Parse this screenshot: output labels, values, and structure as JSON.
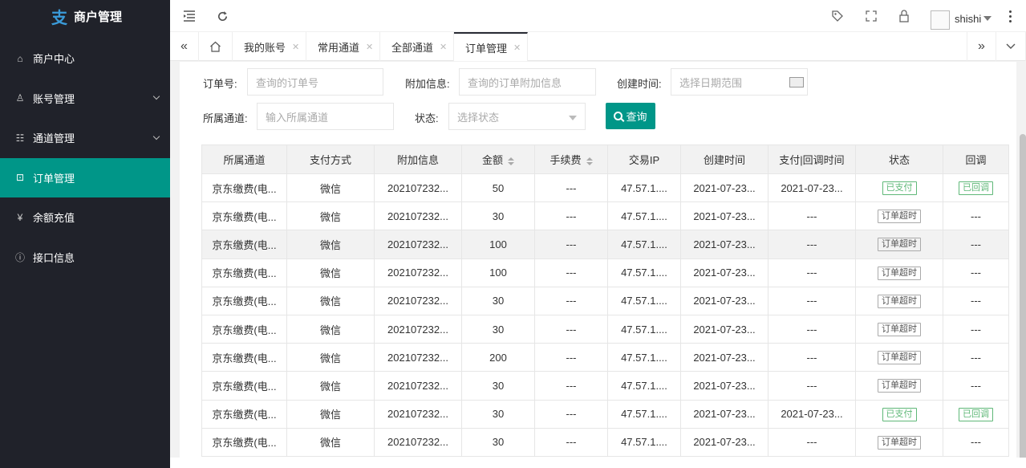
{
  "app": {
    "title": "商户管理"
  },
  "sidebar": {
    "items": [
      {
        "label": "商户中心",
        "icon": "home-icon",
        "glyph": "⌂",
        "expandable": false
      },
      {
        "label": "账号管理",
        "icon": "user-icon",
        "glyph": "♙",
        "expandable": true
      },
      {
        "label": "通道管理",
        "icon": "channel-icon",
        "glyph": "☷",
        "expandable": true
      },
      {
        "label": "订单管理",
        "icon": "cart-icon",
        "glyph": "⊡",
        "expandable": false,
        "active": true
      },
      {
        "label": "余额充值",
        "icon": "yen-icon",
        "glyph": "¥",
        "expandable": false
      },
      {
        "label": "接口信息",
        "icon": "info-icon",
        "glyph": "ⓘ",
        "expandable": false
      }
    ]
  },
  "header": {
    "user_name": "shishi"
  },
  "tabs": [
    {
      "label": "我的账号"
    },
    {
      "label": "常用通道"
    },
    {
      "label": "全部通道"
    },
    {
      "label": "订单管理",
      "active": true
    }
  ],
  "filters": {
    "order_no_label": "订单号:",
    "order_no_placeholder": "查询的订单号",
    "extra_label": "附加信息:",
    "extra_placeholder": "查询的订单附加信息",
    "created_label": "创建时间:",
    "created_placeholder": "选择日期范围",
    "channel_label": "所属通道:",
    "channel_placeholder": "输入所属通道",
    "status_label": "状态:",
    "status_placeholder": "选择状态",
    "query_button": "查询"
  },
  "table": {
    "columns": [
      "所属通道",
      "支付方式",
      "附加信息",
      "金额",
      "手续费",
      "交易IP",
      "创建时间",
      "支付|回调时间",
      "状态",
      "回调"
    ],
    "rows": [
      {
        "channel": "京东缴费(电...",
        "method": "微信",
        "extra": "202107232...",
        "amount": "50",
        "fee": "---",
        "ip": "47.57.1....",
        "created": "2021-07-23...",
        "paid": "2021-07-23...",
        "status": "已支付",
        "status_type": "green",
        "callback": "已回调",
        "callback_type": "green"
      },
      {
        "channel": "京东缴费(电...",
        "method": "微信",
        "extra": "202107232...",
        "amount": "30",
        "fee": "---",
        "ip": "47.57.1....",
        "created": "2021-07-23...",
        "paid": "---",
        "status": "订单超时",
        "status_type": "gray",
        "callback": "---",
        "callback_type": "text"
      },
      {
        "channel": "京东缴费(电...",
        "method": "微信",
        "extra": "202107232...",
        "amount": "100",
        "fee": "---",
        "ip": "47.57.1....",
        "created": "2021-07-23...",
        "paid": "---",
        "status": "订单超时",
        "status_type": "gray",
        "callback": "---",
        "callback_type": "text",
        "highlight": true
      },
      {
        "channel": "京东缴费(电...",
        "method": "微信",
        "extra": "202107232...",
        "amount": "100",
        "fee": "---",
        "ip": "47.57.1....",
        "created": "2021-07-23...",
        "paid": "---",
        "status": "订单超时",
        "status_type": "gray",
        "callback": "---",
        "callback_type": "text"
      },
      {
        "channel": "京东缴费(电...",
        "method": "微信",
        "extra": "202107232...",
        "amount": "30",
        "fee": "---",
        "ip": "47.57.1....",
        "created": "2021-07-23...",
        "paid": "---",
        "status": "订单超时",
        "status_type": "gray",
        "callback": "---",
        "callback_type": "text"
      },
      {
        "channel": "京东缴费(电...",
        "method": "微信",
        "extra": "202107232...",
        "amount": "30",
        "fee": "---",
        "ip": "47.57.1....",
        "created": "2021-07-23...",
        "paid": "---",
        "status": "订单超时",
        "status_type": "gray",
        "callback": "---",
        "callback_type": "text"
      },
      {
        "channel": "京东缴费(电...",
        "method": "微信",
        "extra": "202107232...",
        "amount": "200",
        "fee": "---",
        "ip": "47.57.1....",
        "created": "2021-07-23...",
        "paid": "---",
        "status": "订单超时",
        "status_type": "gray",
        "callback": "---",
        "callback_type": "text"
      },
      {
        "channel": "京东缴费(电...",
        "method": "微信",
        "extra": "202107232...",
        "amount": "30",
        "fee": "---",
        "ip": "47.57.1....",
        "created": "2021-07-23...",
        "paid": "---",
        "status": "订单超时",
        "status_type": "gray",
        "callback": "---",
        "callback_type": "text"
      },
      {
        "channel": "京东缴费(电...",
        "method": "微信",
        "extra": "202107232...",
        "amount": "30",
        "fee": "---",
        "ip": "47.57.1....",
        "created": "2021-07-23...",
        "paid": "2021-07-23...",
        "status": "已支付",
        "status_type": "green",
        "callback": "已回调",
        "callback_type": "green"
      },
      {
        "channel": "京东缴费(电...",
        "method": "微信",
        "extra": "202107232...",
        "amount": "30",
        "fee": "---",
        "ip": "47.57.1....",
        "created": "2021-07-23...",
        "paid": "---",
        "status": "订单超时",
        "status_type": "gray",
        "callback": "---",
        "callback_type": "text"
      }
    ]
  },
  "colors": {
    "sidebar_bg": "#20222a",
    "accent": "#009688",
    "success": "#5fb878"
  }
}
